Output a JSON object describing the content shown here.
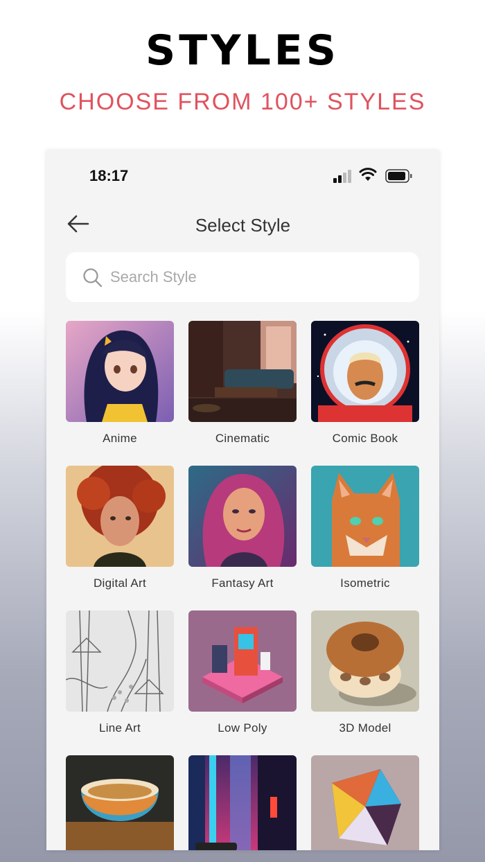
{
  "promo": {
    "title": "STYLES",
    "subtitle": "CHOOSE FROM 100+ STYLES"
  },
  "status_bar": {
    "time": "18:17"
  },
  "nav": {
    "title": "Select Style"
  },
  "search": {
    "placeholder": "Search Style",
    "value": ""
  },
  "styles": [
    {
      "label": "Anime",
      "icon": "anime-girl-image"
    },
    {
      "label": "Cinematic",
      "icon": "cinematic-room-image"
    },
    {
      "label": "Comic Book",
      "icon": "comic-astronaut-image"
    },
    {
      "label": "Digital Art",
      "icon": "digital-art-portrait-image"
    },
    {
      "label": "Fantasy Art",
      "icon": "fantasy-portrait-image"
    },
    {
      "label": "Isometric",
      "icon": "isometric-cat-image"
    },
    {
      "label": "Line Art",
      "icon": "line-art-forest-image"
    },
    {
      "label": "Low Poly",
      "icon": "low-poly-machine-image"
    },
    {
      "label": "3D Model",
      "icon": "3d-donut-image"
    },
    {
      "label": "",
      "icon": "bowl-image"
    },
    {
      "label": "",
      "icon": "neon-city-image"
    },
    {
      "label": "",
      "icon": "geometric-shape-image"
    }
  ],
  "colors": {
    "accent": "#e0525e",
    "background": "#f4f4f4"
  }
}
